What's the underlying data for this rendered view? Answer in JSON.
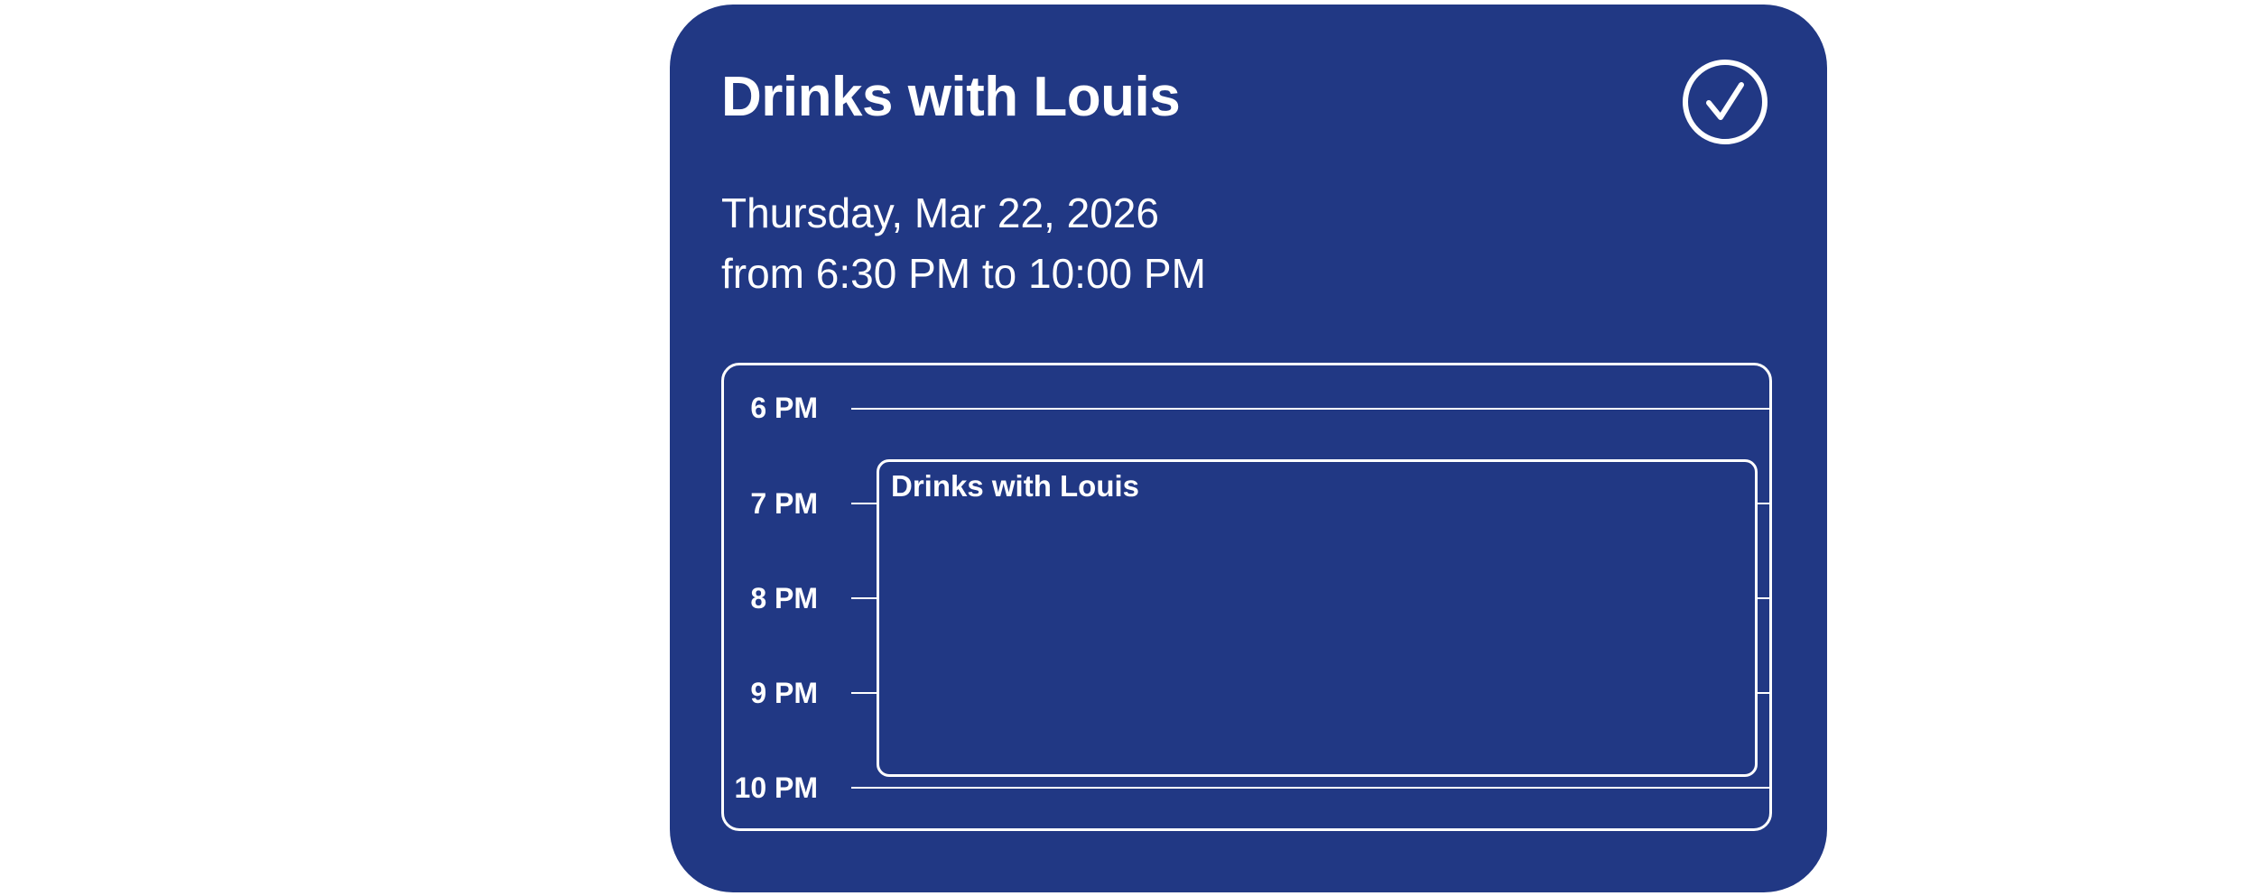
{
  "event": {
    "title": "Drinks with Louis",
    "date": "Thursday, Mar 22, 2026",
    "time_range": "from 6:30 PM to 10:00 PM",
    "completed_icon": "checkmark-circle-icon"
  },
  "timeline": {
    "hours": [
      "6 PM",
      "7 PM",
      "8 PM",
      "9 PM",
      "10 PM"
    ],
    "event_label": "Drinks with Louis"
  },
  "colors": {
    "card_background": "#213884",
    "foreground": "#ffffff",
    "page_background": "#ffffff"
  }
}
